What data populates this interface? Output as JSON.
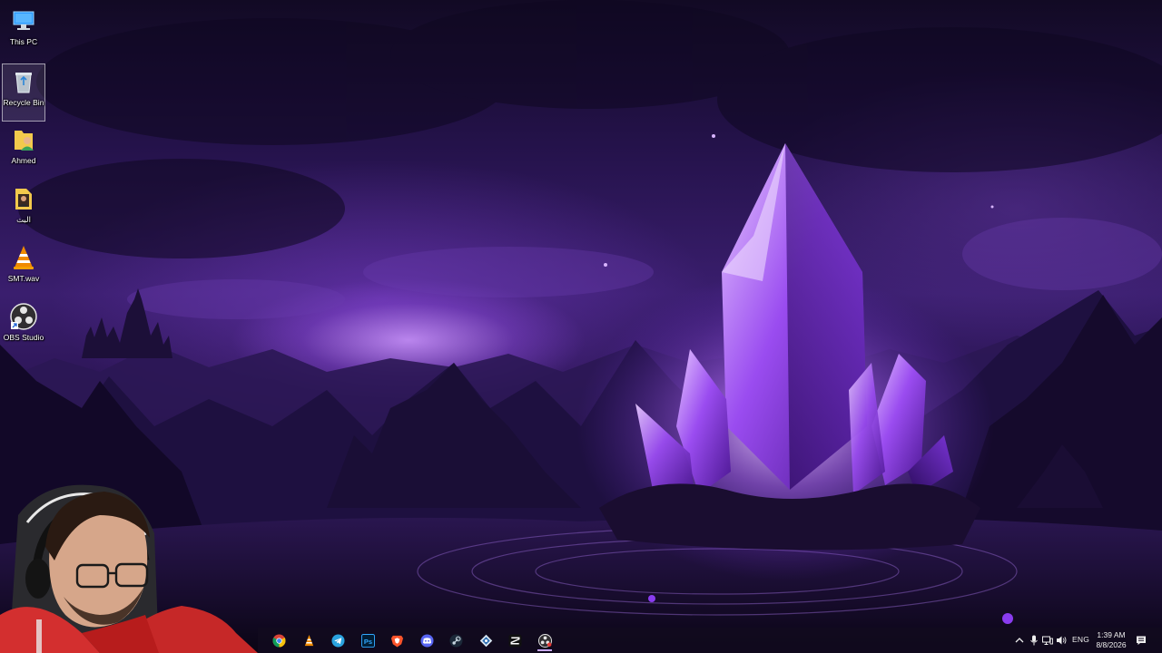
{
  "desktop": {
    "icons": [
      {
        "label": "This PC",
        "icon": "this-pc-icon"
      },
      {
        "label": "Recycle Bin",
        "icon": "recycle-bin-icon",
        "selected": true
      },
      {
        "label": "Ahmed",
        "icon": "user-folder-icon"
      },
      {
        "label": "البث",
        "icon": "folder-icon"
      },
      {
        "label": "SMT.wav",
        "icon": "vlc-cone-icon"
      },
      {
        "label": "OBS Studio",
        "icon": "obs-studio-icon"
      }
    ]
  },
  "taskbar": {
    "apps": [
      {
        "name": "Google Chrome",
        "icon": "chrome-icon"
      },
      {
        "name": "VLC media player",
        "icon": "vlc-cone-icon"
      },
      {
        "name": "Telegram",
        "icon": "telegram-icon"
      },
      {
        "name": "Photoshop",
        "icon": "photoshop-icon",
        "text": "Ps"
      },
      {
        "name": "Brave",
        "icon": "brave-icon"
      },
      {
        "name": "Discord",
        "icon": "discord-icon"
      },
      {
        "name": "Steam",
        "icon": "steam-icon"
      },
      {
        "name": "Network tool",
        "icon": "diamond-app-icon"
      },
      {
        "name": "CapCut",
        "icon": "capcut-icon"
      },
      {
        "name": "OBS Studio",
        "icon": "obs-studio-icon",
        "active": true
      }
    ],
    "tray": {
      "language": "ENG",
      "time": "1:39 AM",
      "date": "8/8/2026"
    }
  },
  "colors": {
    "accent": "#8a4bff",
    "taskbar_bg": "#120a1e",
    "crystal": "#b070ff"
  }
}
